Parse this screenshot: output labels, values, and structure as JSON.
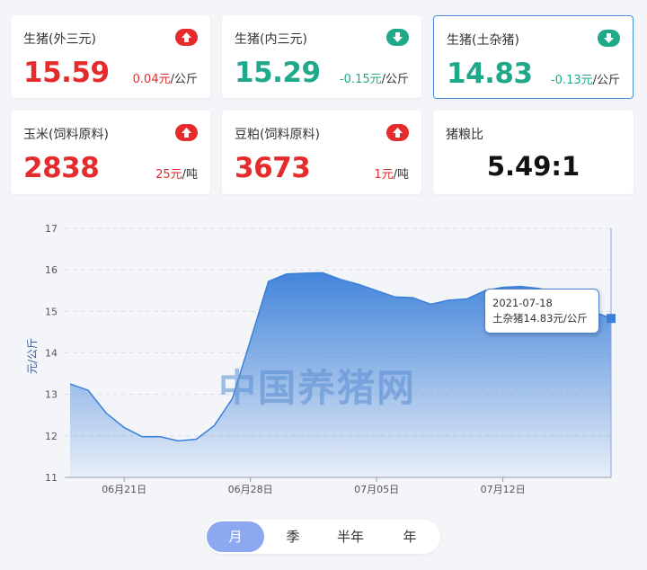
{
  "cards": [
    {
      "title": "生猪(外三元)",
      "value": "15.59",
      "change": "0.04元",
      "unit": "/公斤",
      "trend": "up",
      "arrow_icon": "arrow-up-icon"
    },
    {
      "title": "生猪(内三元)",
      "value": "15.29",
      "change": "-0.15元",
      "unit": "/公斤",
      "trend": "down",
      "arrow_icon": "arrow-down-icon"
    },
    {
      "title": "生猪(土杂猪)",
      "value": "14.83",
      "change": "-0.13元",
      "unit": "/公斤",
      "trend": "down",
      "arrow_icon": "arrow-down-icon"
    },
    {
      "title": "玉米(饲料原料)",
      "value": "2838",
      "change": "25元",
      "unit": "/吨",
      "trend": "up",
      "arrow_icon": "arrow-up-icon"
    },
    {
      "title": "豆粕(饲料原料)",
      "value": "3673",
      "change": "1元",
      "unit": "/吨",
      "trend": "up",
      "arrow_icon": "arrow-up-icon"
    },
    {
      "title": "猪粮比",
      "value": "5.49:1"
    }
  ],
  "colors": {
    "up": "#e52b2b",
    "down": "#1fa98a",
    "accent": "#4a90d9",
    "series": "#3a7fd9"
  },
  "watermark": "中国养猪网",
  "tooltip": {
    "date": "2021-07-18",
    "label": "土杂猪14.83元/公斤"
  },
  "period_tabs": [
    {
      "label": "月",
      "active": true
    },
    {
      "label": "季",
      "active": false
    },
    {
      "label": "半年",
      "active": false
    },
    {
      "label": "年",
      "active": false
    }
  ],
  "chart_data": {
    "type": "area",
    "ylabel": "元/公斤",
    "ylim": [
      11,
      17
    ],
    "yticks": [
      11,
      12,
      13,
      14,
      15,
      16,
      17
    ],
    "grid": true,
    "x": [
      "2021-06-18",
      "2021-06-19",
      "2021-06-20",
      "2021-06-21",
      "2021-06-22",
      "2021-06-23",
      "2021-06-24",
      "2021-06-25",
      "2021-06-26",
      "2021-06-27",
      "2021-06-28",
      "2021-06-29",
      "2021-06-30",
      "2021-07-01",
      "2021-07-02",
      "2021-07-03",
      "2021-07-04",
      "2021-07-05",
      "2021-07-06",
      "2021-07-07",
      "2021-07-08",
      "2021-07-09",
      "2021-07-10",
      "2021-07-11",
      "2021-07-12",
      "2021-07-13",
      "2021-07-14",
      "2021-07-15",
      "2021-07-16",
      "2021-07-17",
      "2021-07-18"
    ],
    "xtick_labels": [
      {
        "index": 3,
        "label": "06月21日"
      },
      {
        "index": 10,
        "label": "06月28日"
      },
      {
        "index": 17,
        "label": "07月05日"
      },
      {
        "index": 24,
        "label": "07月12日"
      }
    ],
    "series": [
      {
        "name": "土杂猪",
        "values": [
          13.25,
          13.1,
          12.55,
          12.2,
          11.98,
          11.98,
          11.88,
          11.92,
          12.25,
          12.9,
          14.3,
          15.72,
          15.9,
          15.92,
          15.93,
          15.77,
          15.65,
          15.5,
          15.35,
          15.33,
          15.17,
          15.27,
          15.3,
          15.5,
          15.58,
          15.6,
          15.55,
          15.45,
          15.2,
          15.0,
          14.83
        ]
      }
    ]
  }
}
